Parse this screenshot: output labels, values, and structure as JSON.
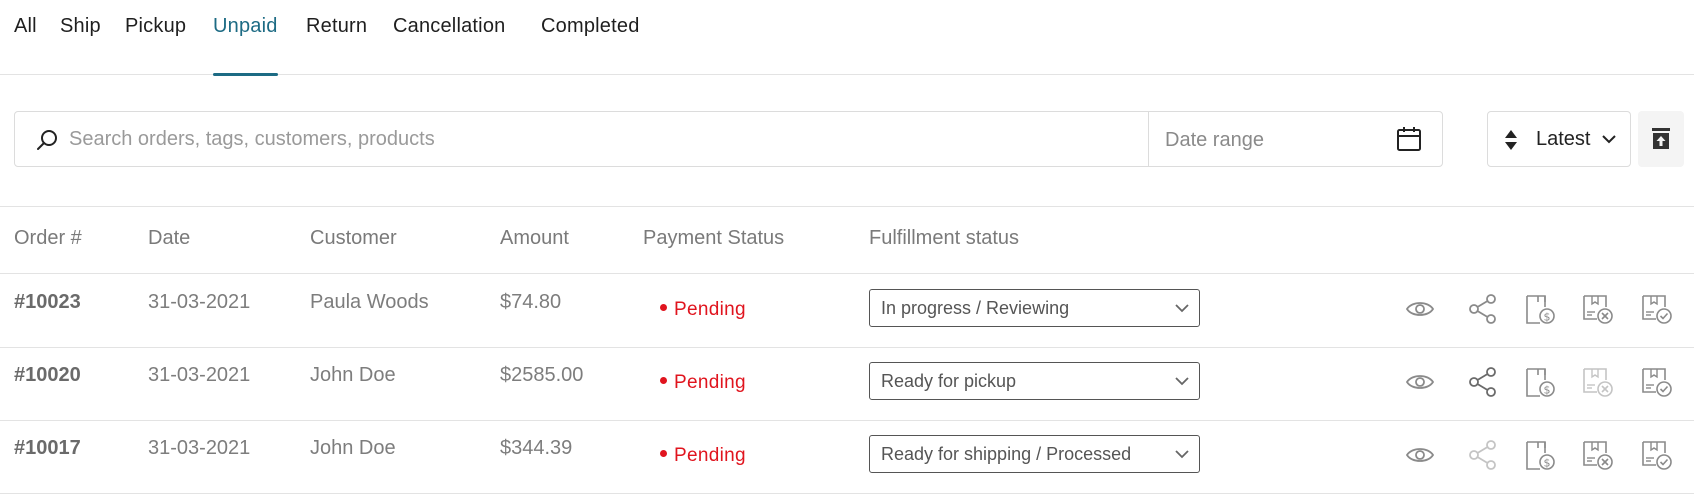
{
  "tabs": [
    {
      "label": "All"
    },
    {
      "label": "Ship"
    },
    {
      "label": "Pickup"
    },
    {
      "label": "Unpaid",
      "active": true
    },
    {
      "label": "Return"
    },
    {
      "label": "Cancellation"
    },
    {
      "label": "Completed"
    }
  ],
  "filters": {
    "search_placeholder": "Search orders, tags, customers, products",
    "date_range_label": "Date range",
    "sort_label": "Latest"
  },
  "table": {
    "headers": [
      "Order #",
      "Date",
      "Customer",
      "Amount",
      "Payment Status",
      "Fulfillment status"
    ],
    "rows": [
      {
        "order": "#10023",
        "date": "31-03-2021",
        "customer": "Paula Woods",
        "amount": "$74.80",
        "payment_status": "Pending",
        "fulfillment": "In progress / Reviewing",
        "share_enabled": true
      },
      {
        "order": "#10020",
        "date": "31-03-2021",
        "customer": "John Doe",
        "amount": "$2585.00",
        "payment_status": "Pending",
        "fulfillment": "Ready for pickup",
        "share_enabled": true
      },
      {
        "order": "#10017",
        "date": "31-03-2021",
        "customer": "John Doe",
        "amount": "$344.39",
        "payment_status": "Pending",
        "fulfillment": "Ready for shipping / Processed",
        "share_enabled": false
      }
    ]
  },
  "colors": {
    "accent": "#1d6b84",
    "pending": "#e0141e",
    "icon_gray": "#8a8a8a",
    "icon_disabled": "#c4c4c4"
  },
  "icons": [
    "search-icon",
    "calendar-icon",
    "sort-icon",
    "chevron-down-icon",
    "archive-icon",
    "eye-icon",
    "share-icon",
    "invoice-icon",
    "cancel-package-icon",
    "complete-package-icon"
  ]
}
